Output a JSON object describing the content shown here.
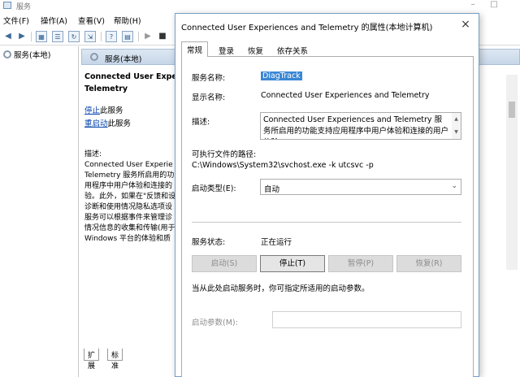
{
  "bg": {
    "title": "服务",
    "menu": [
      "文件(F)",
      "操作(A)",
      "查看(V)",
      "帮助(H)"
    ],
    "tree_root": "服务(本地)",
    "header": "服务(本地)",
    "desc_title_line1": "Connected User Experien",
    "desc_title_line2": "Telemetry",
    "stop_link": "停止",
    "stop_suffix": "此服务",
    "restart_link": "重启动",
    "restart_suffix": "此服务",
    "desc_label": "描述:",
    "desc_lines": [
      "Connected User Experie",
      "Telemetry 服务所启用的功",
      "用程序中用户体验和连接的",
      "验。此外，如果在\"反馈和设",
      "诊断和使用情况隐私选项设",
      "服务可以根据事件来管理诊",
      "情况信息的收集和传输(用于",
      "Windows 平台的体验和质"
    ],
    "tabs": [
      "扩展",
      "标准"
    ]
  },
  "dialog": {
    "title": "Connected User Experiences and Telemetry 的属性(本地计算机)",
    "close_glyph": "×",
    "tabs": [
      "常规",
      "登录",
      "恢复",
      "依存关系"
    ],
    "service_name_label": "服务名称:",
    "service_name": "DiagTrack",
    "display_name_label": "显示名称:",
    "display_name": "Connected User Experiences and Telemetry",
    "description_label": "描述:",
    "description": "Connected User Experiences and Telemetry 服务所启用的功能支持应用程序中用户体验和连接的用户体验",
    "exec_path_label": "可执行文件的路径:",
    "exec_path": "C:\\Windows\\System32\\svchost.exe -k utcsvc -p",
    "startup_type_label": "启动类型(E):",
    "startup_type": "自动",
    "status_label": "服务状态:",
    "status": "正在运行",
    "buttons": {
      "start": "启动(S)",
      "stop": "停止(T)",
      "pause": "暂停(P)",
      "resume": "恢复(R)"
    },
    "hint": "当从此处启动服务时，你可指定所适用的启动参数。",
    "params_label": "启动参数(M):"
  }
}
